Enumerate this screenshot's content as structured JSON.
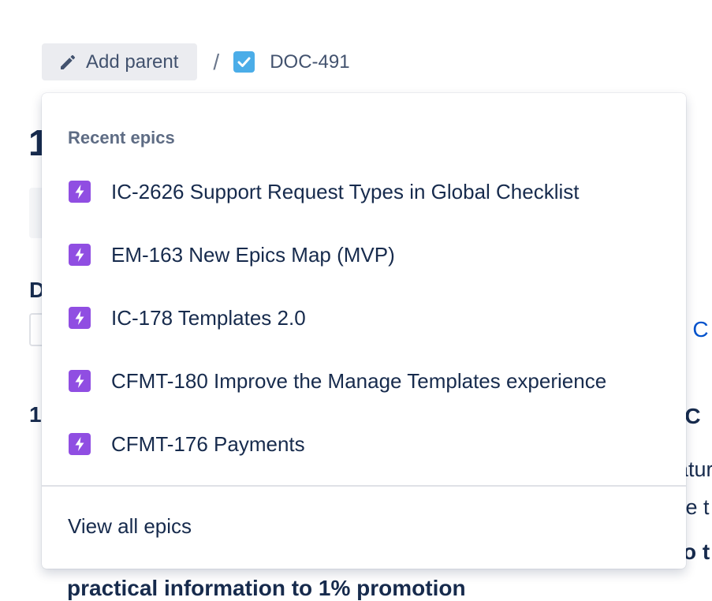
{
  "breadcrumb": {
    "add_parent_label": "Add parent",
    "separator": "/",
    "issue_key": "DOC-491"
  },
  "background": {
    "title_fragment": "1",
    "heading_d": "D",
    "link_fragment": "p C",
    "heading_1": "1",
    "right_heading": "e C",
    "right_line_1": "atur",
    "right_line_2": "te t",
    "right_bold": "o t",
    "bottom_line": "practical information to 1% promotion"
  },
  "dropdown": {
    "section_title": "Recent epics",
    "epics": [
      {
        "label": "IC-2626 Support Request Types in Global Checklist"
      },
      {
        "label": "EM-163 New Epics Map (MVP)"
      },
      {
        "label": "IC-178 Templates 2.0"
      },
      {
        "label": "CFMT-180 Improve the Manage Templates experience"
      },
      {
        "label": "CFMT-176 Payments"
      }
    ],
    "view_all_label": "View all epics"
  },
  "icons": {
    "add_parent": "pencil-icon",
    "issue_type": "task-checkbox-icon",
    "epic": "epic-lightning-icon"
  },
  "colors": {
    "epic_purple": "#904ee2",
    "task_blue": "#4bade8",
    "text_primary": "#172b4d",
    "text_subtle": "#5e6c84",
    "button_bg": "#ebecf0",
    "link_blue": "#0052cc"
  }
}
